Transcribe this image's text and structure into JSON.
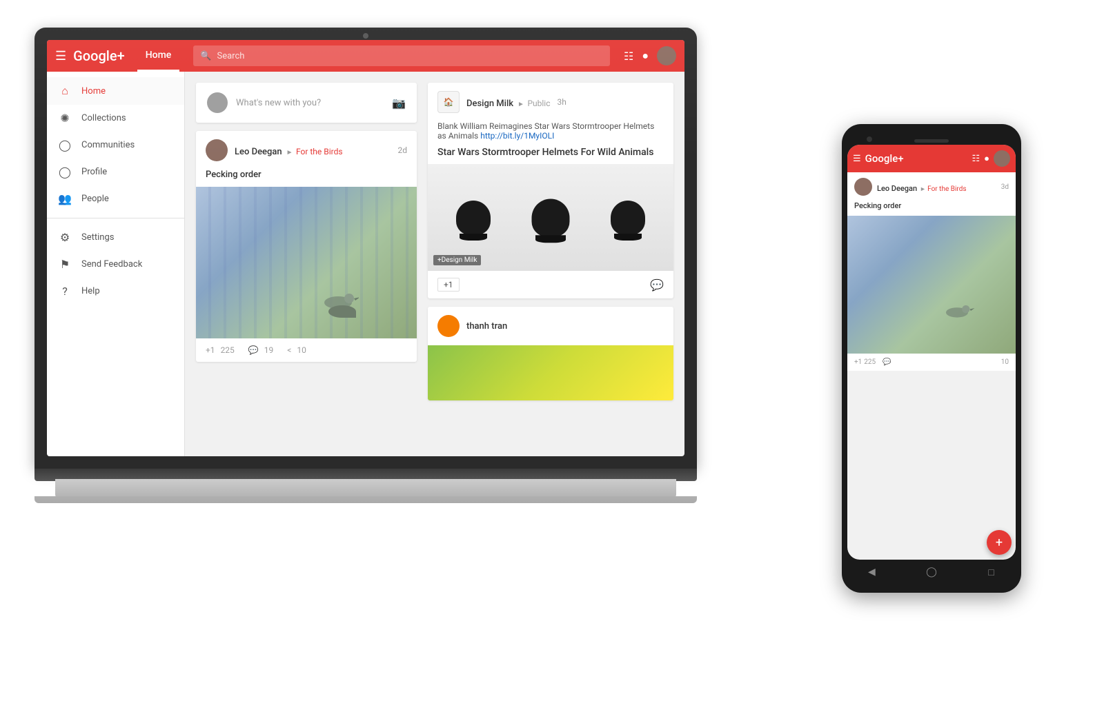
{
  "scene": {
    "background": "#ffffff"
  },
  "laptop": {
    "header": {
      "logo": "Google+",
      "nav_home": "Home",
      "search_placeholder": "Search"
    },
    "sidebar": {
      "items": [
        {
          "label": "Home",
          "active": true
        },
        {
          "label": "Collections"
        },
        {
          "label": "Communities"
        },
        {
          "label": "Profile"
        },
        {
          "label": "People"
        },
        {
          "label": "Settings"
        },
        {
          "label": "Send Feedback"
        },
        {
          "label": "Help"
        }
      ]
    },
    "left_post": {
      "author": "Leo Deegan",
      "collection": "For the Birds",
      "time": "2d",
      "title": "Pecking order",
      "plus_count": "225",
      "comment_count": "19",
      "share_count": "10"
    },
    "compose": {
      "placeholder": "What's new with you?"
    },
    "right_post": {
      "brand": "Design Milk",
      "visibility": "Public",
      "time": "3h",
      "headline": "Blank William Reimagines Star Wars Stormtrooper Helmets as Animals",
      "link": "http://bit.ly/1MyIOLI",
      "title": "Star Wars Stormtrooper Helmets For Wild Animals",
      "tag": "+Design Milk"
    },
    "thanh_post": {
      "author": "thanh tran"
    }
  },
  "phone": {
    "header": {
      "logo": "Google+"
    },
    "post": {
      "author": "Leo Deegan",
      "collection": "For the Birds",
      "time": "3d",
      "title": "Pecking order",
      "plus_count": "225",
      "comment_count": "",
      "share_count": "10"
    },
    "fab_label": "+"
  }
}
